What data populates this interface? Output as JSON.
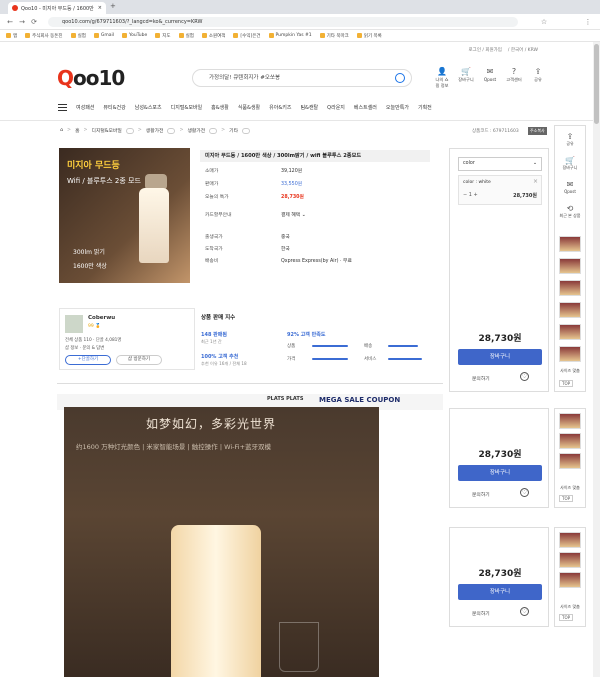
{
  "browser": {
    "tab_title": "Qoo10 - 미지아 무드등 / 1600만",
    "url": "qoo10.com/g/679711603/?_langcd=ko&_currency=KRW",
    "bookmarks": [
      "앱",
      "주식회사 동돈진",
      "실험",
      "Gmail",
      "YouTube",
      "지도",
      "실험",
      "소원여객",
      "[수익]은건",
      "Pumpkin Yas #1",
      "기타 북마크",
      "읽기 목록"
    ]
  },
  "header": {
    "top_links": [
      "로그인 / 회원가입",
      "/ 한국어 / KRW"
    ],
    "logo": "Qoo10",
    "search_placeholder": "가정의달! 큐텐회지가 #오쏘봉",
    "icons": [
      {
        "name": "user-icon",
        "label": "나의 쇼핑 정보",
        "glyph": "👤"
      },
      {
        "name": "cart-icon",
        "label": "장바구니",
        "glyph": "🛒"
      },
      {
        "name": "mail-icon",
        "label": "Qpost",
        "glyph": "✉"
      },
      {
        "name": "help-icon",
        "label": "고객센터",
        "glyph": "?"
      },
      {
        "name": "share-icon",
        "label": "공유",
        "glyph": "⇪"
      }
    ],
    "menu": [
      "여성패션",
      "뷰티&건강",
      "남성&스포츠",
      "디지털&모바일",
      "홈&생활",
      "식품&생활",
      "유아&키즈",
      "팀&캔탈",
      "Q라운지",
      "베스트셀러",
      "오늘만특가",
      "기획전"
    ]
  },
  "breadcrumb": {
    "items": [
      "홈",
      "디지털&모바일",
      "생활가전",
      "생활가전",
      "기타"
    ],
    "product_no_label": "상품코드 : 679711603",
    "copy_label": "주소복사"
  },
  "product_image": {
    "title": "미지아 무드등",
    "subtitle": "Wifi / 블루투스 2종 모드",
    "line1": "300lm 밝기",
    "line2": "1600만 색상"
  },
  "product": {
    "title": "미지아 무드등 / 1600만 색상 / 300lm밝기 / wifi 블루투스 2종모드",
    "rows": [
      {
        "k": "소매가",
        "v": "39,120원",
        "style": ""
      },
      {
        "k": "판매가",
        "v": "33,550원",
        "style": "blue"
      },
      {
        "k": "오늘의 특가",
        "v": "28,730원",
        "style": "red"
      },
      {
        "k": "카드할부안내",
        "v": "결제 혜택 ⌄",
        "style": ""
      },
      {
        "k": "출생국가",
        "v": "중국",
        "style": ""
      },
      {
        "k": "도착국가",
        "v": "한국",
        "style": ""
      },
      {
        "k": "배송비",
        "v": "Qxpress Express(by Air) · 무료",
        "style": ""
      }
    ]
  },
  "seller": {
    "name": "Coberwu",
    "score_text": "99 🏅",
    "stats": "전체 상품 110 · 단골 4,081명",
    "links": "샵 정보 · 문의 & 답변",
    "follow_btn": "+단골하기",
    "visit_btn": "샵 방문하기"
  },
  "sales": {
    "title": "상품 판매 지수",
    "sold": "148 판매됨",
    "sold_sub": "최근 1년 간",
    "recommend": "100% 고객 추천",
    "recommend_sub": "추천 이유 16개 / 전체 18",
    "satisfaction": "92% 고객 만족도",
    "bars": [
      "상품",
      "배송",
      "가격",
      "서비스"
    ]
  },
  "banners": [
    "PLATS PLATS",
    "MEGA SALE COUPON"
  ],
  "detail": {
    "headline": "如梦如幻，多彩光世界",
    "sub": "约1600 万种灯光颜色 | 米家智能场景 | 触控操作 | Wi-Fi+蓝牙双模"
  },
  "purchase": {
    "color_label": "color",
    "option_text": "color : white",
    "qty": "1",
    "option_price": "28,730원",
    "price": "28,730원",
    "cart_label": "장바구니",
    "inquiry_label": "문의하기"
  },
  "sidebar": {
    "icons": [
      {
        "name": "share-icon",
        "label": "공유",
        "glyph": "⇪"
      },
      {
        "name": "cart-icon",
        "label": "장바구니",
        "glyph": "🛒"
      },
      {
        "name": "mail-icon",
        "label": "Qpost",
        "glyph": "✉"
      },
      {
        "name": "history-icon",
        "label": "최근 본 상품",
        "glyph": "⟲"
      }
    ],
    "similar_label": "사이즈 맞춤",
    "top_label": "TOP"
  }
}
